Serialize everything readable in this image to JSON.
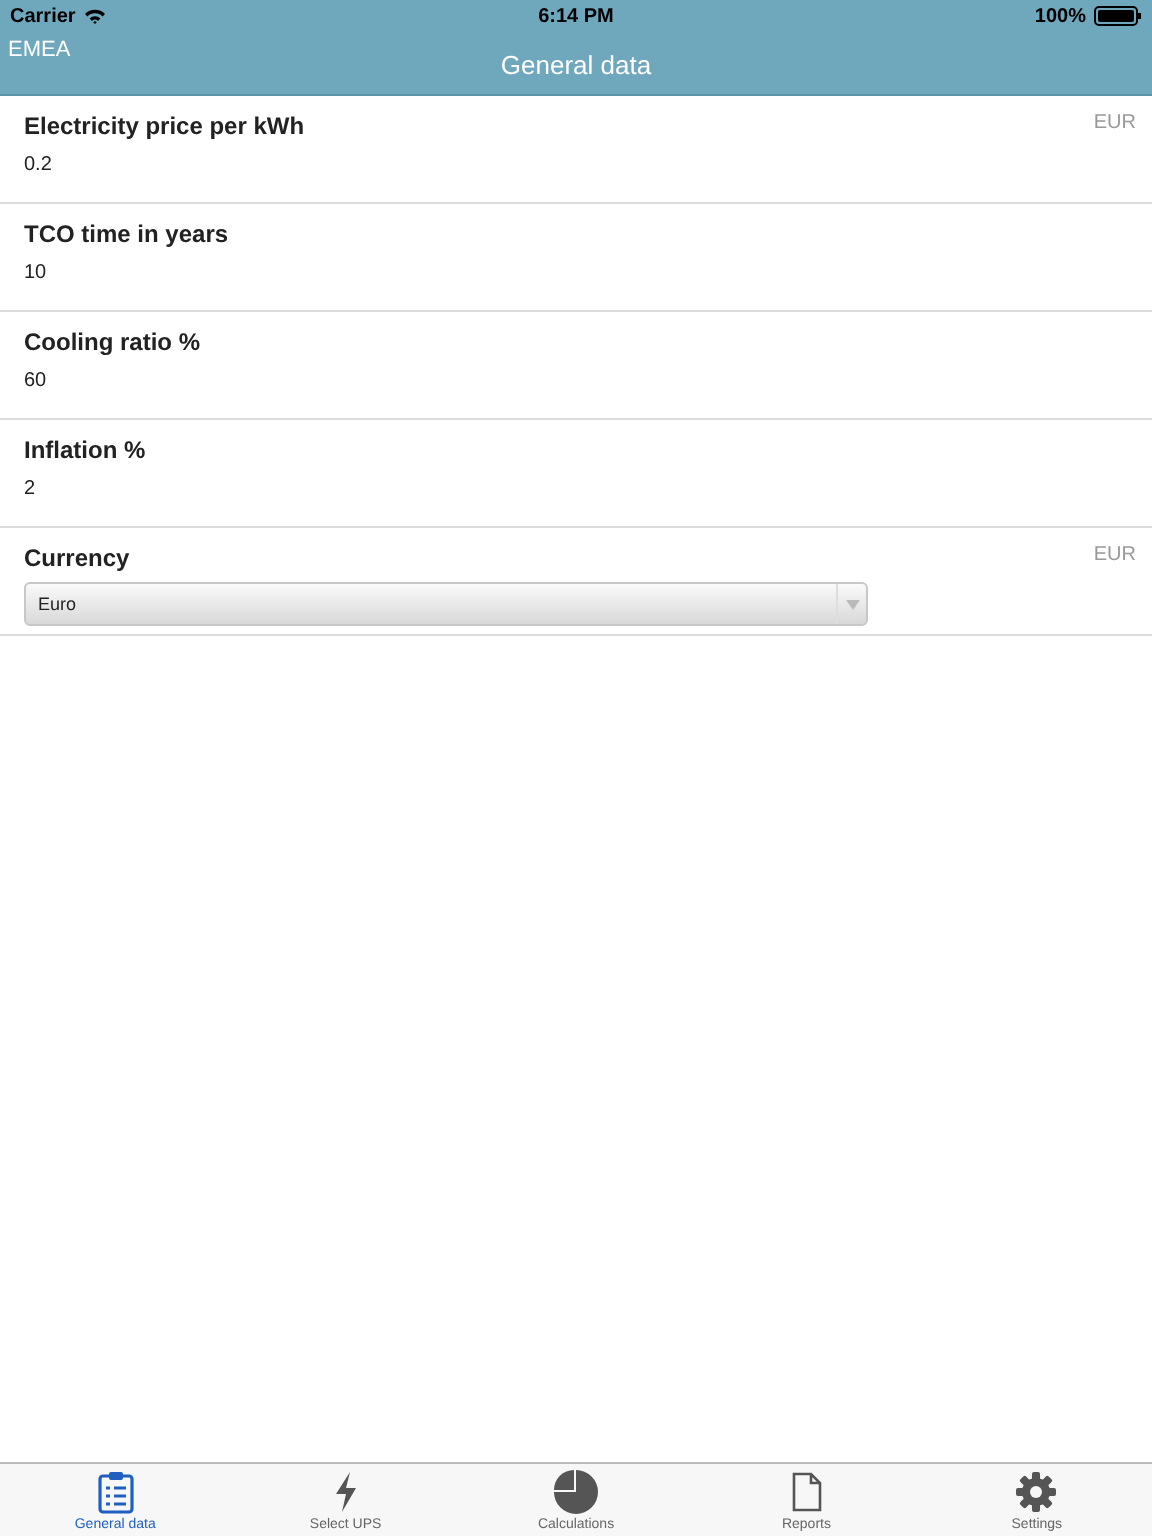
{
  "status_bar": {
    "carrier": "Carrier",
    "time": "6:14 PM",
    "battery": "100%"
  },
  "nav_bar": {
    "back": "EMEA",
    "title": "General data"
  },
  "fields": [
    {
      "kind": "input",
      "label": "Electricity price per kWh",
      "value": "0.2",
      "unit": "EUR"
    },
    {
      "kind": "input",
      "label": "TCO time in years",
      "value": "10"
    },
    {
      "kind": "input",
      "label": "Cooling ratio %",
      "value": "60"
    },
    {
      "kind": "input",
      "label": "Inflation %",
      "value": "2"
    },
    {
      "kind": "select",
      "label": "Currency",
      "value": "Euro",
      "unit": "EUR"
    }
  ],
  "tabs": [
    {
      "label": "General data",
      "selected": true
    },
    {
      "label": "Select UPS",
      "selected": false
    },
    {
      "label": "Calculations",
      "selected": false
    },
    {
      "label": "Reports",
      "selected": false
    },
    {
      "label": "Settings",
      "selected": false
    }
  ]
}
